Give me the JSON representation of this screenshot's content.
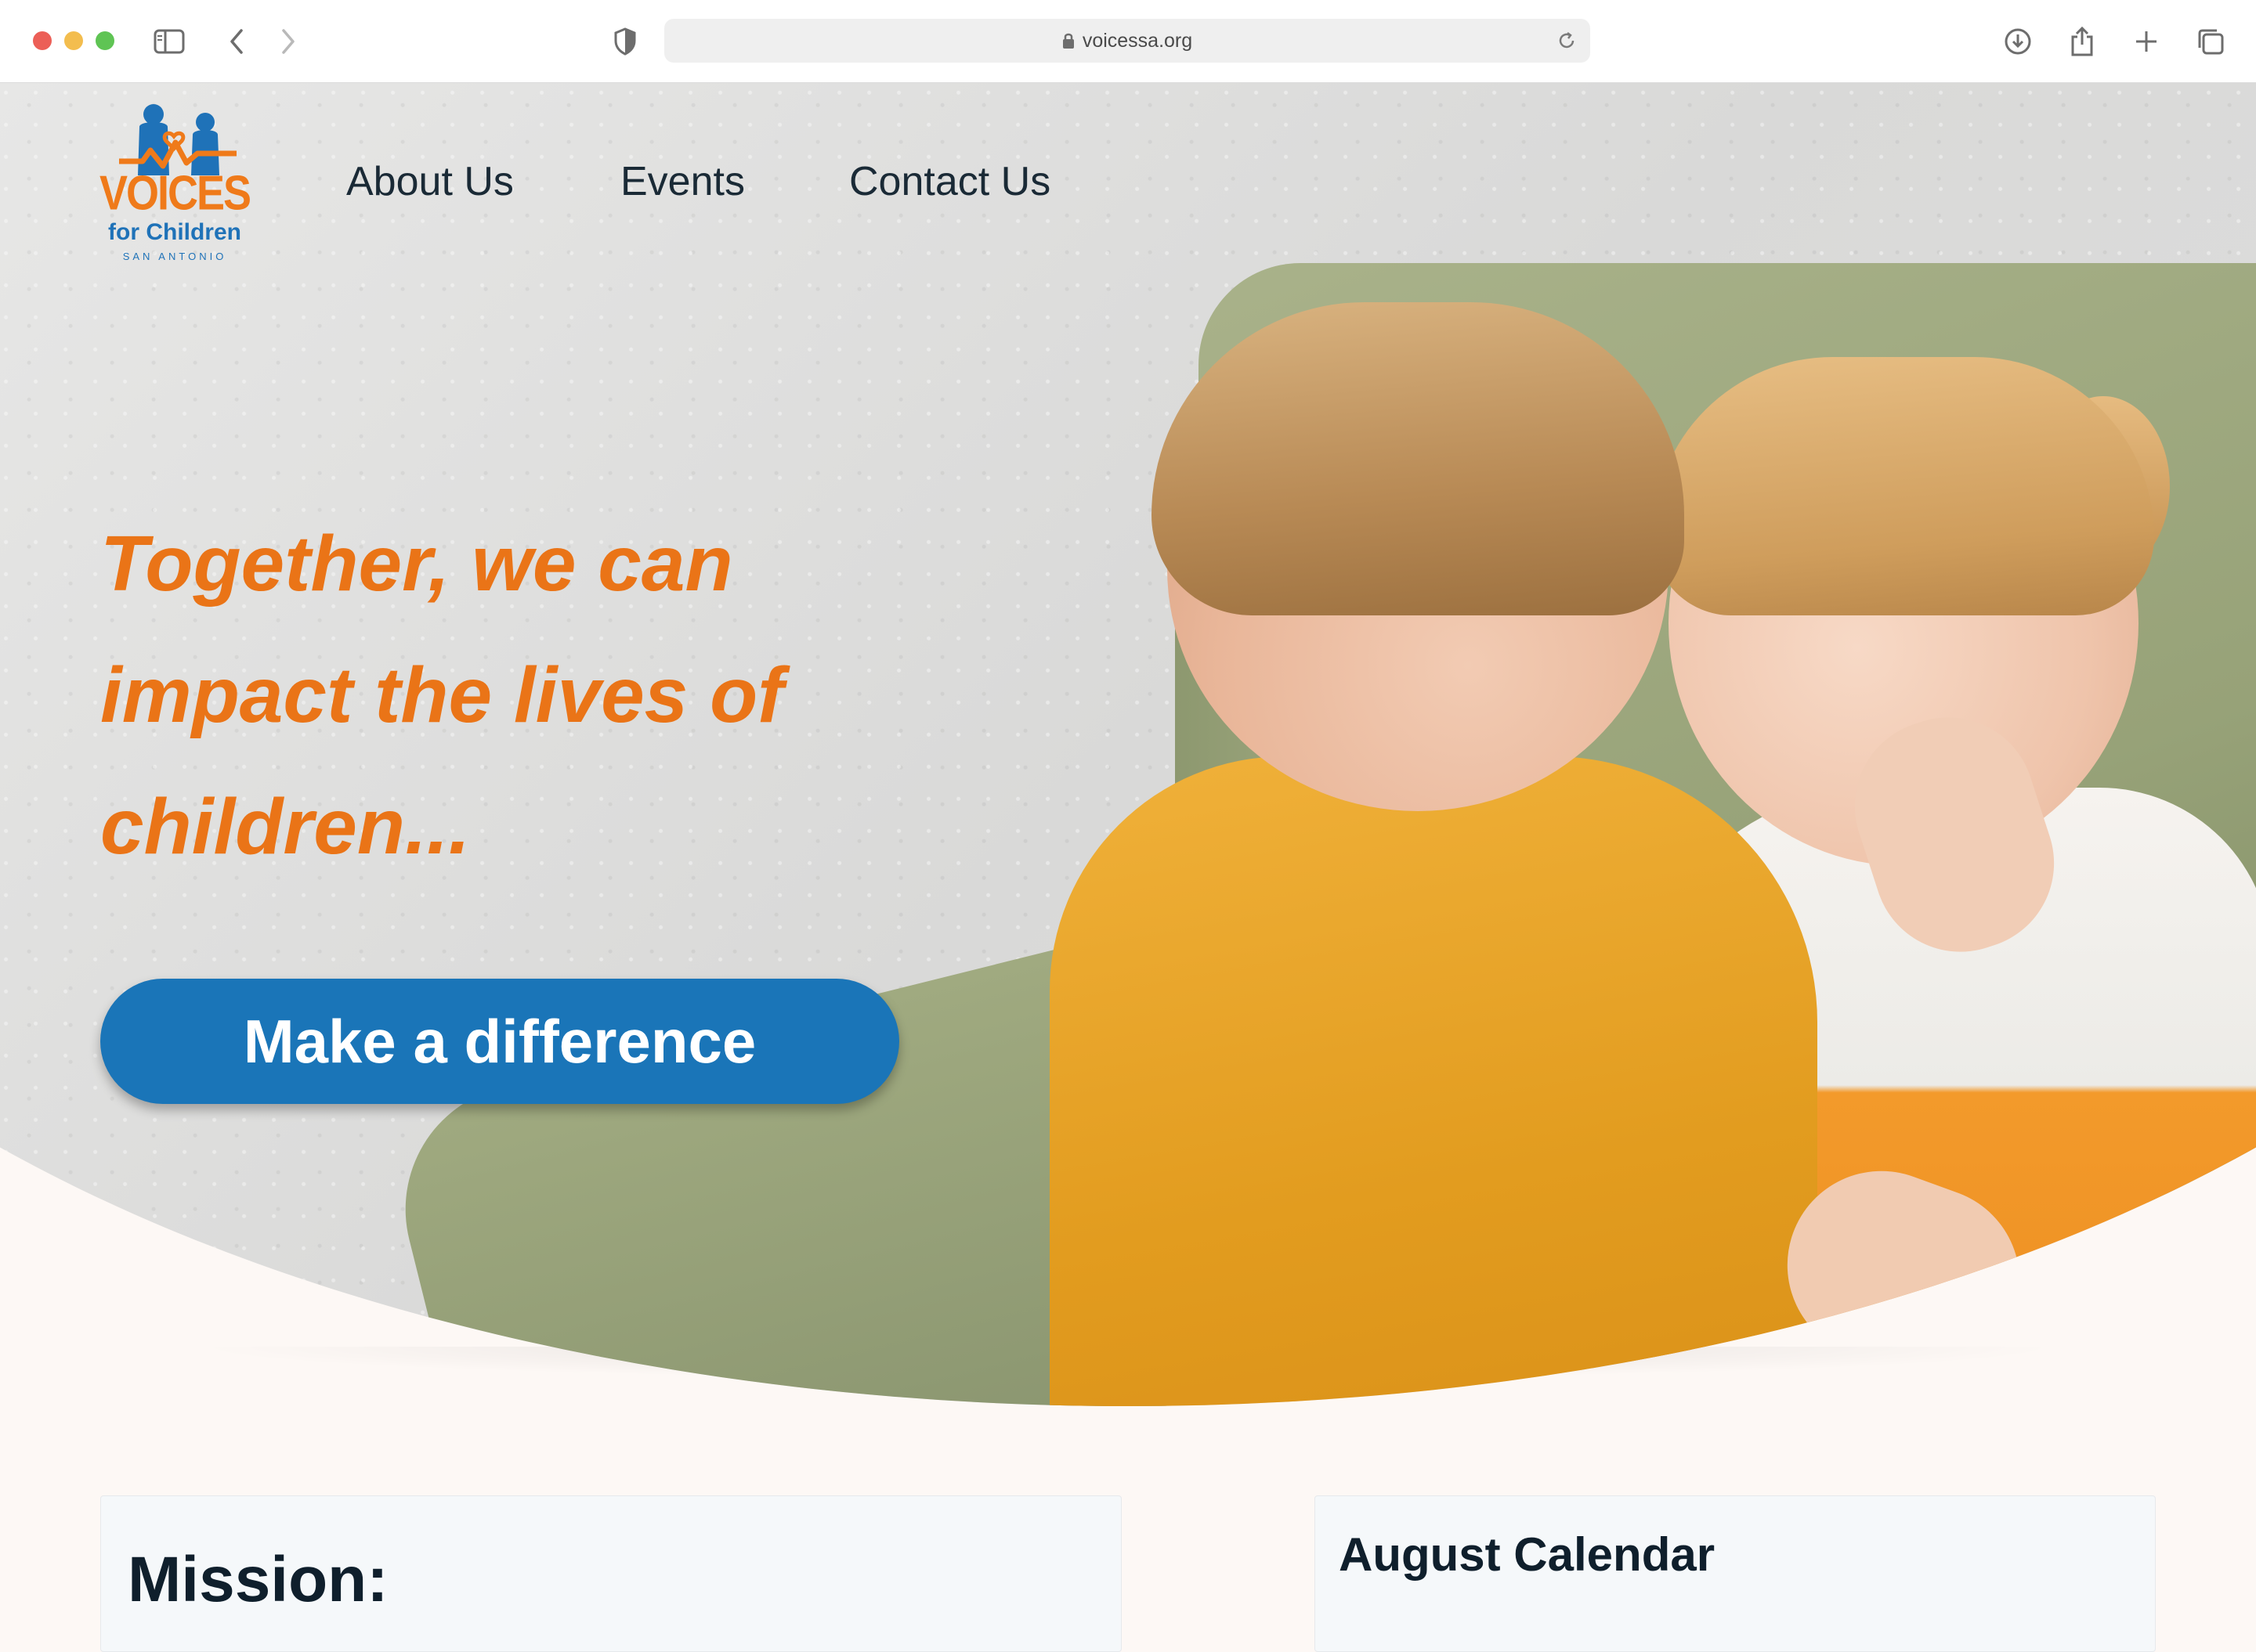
{
  "browser": {
    "url": "voicessa.org",
    "traffic_lights": {
      "close": "#ec5f57",
      "minimize": "#f3bd4e",
      "maximize": "#5fc454"
    },
    "icons": [
      "sidebar-icon",
      "back-icon",
      "forward-icon",
      "shield-icon",
      "lock-icon",
      "reload-icon",
      "download-icon",
      "share-icon",
      "new-tab-icon",
      "tab-overview-icon"
    ]
  },
  "logo": {
    "line1": "VOICES",
    "line2": "for Children",
    "line3": "SAN ANTONIO"
  },
  "nav": {
    "items": [
      {
        "label": "About Us"
      },
      {
        "label": "Events"
      },
      {
        "label": "Contact Us"
      }
    ]
  },
  "hero": {
    "tagline_line1": "Together, we can",
    "tagline_line2": "impact the lives of",
    "tagline_line3": "children...",
    "cta_label": "Make a difference"
  },
  "sections": {
    "mission_title": "Mission:",
    "calendar_title": "August Calendar"
  },
  "colors": {
    "accent_orange": "#ea7417",
    "brand_blue": "#1a75b8",
    "nav_text": "#1a2a36"
  }
}
